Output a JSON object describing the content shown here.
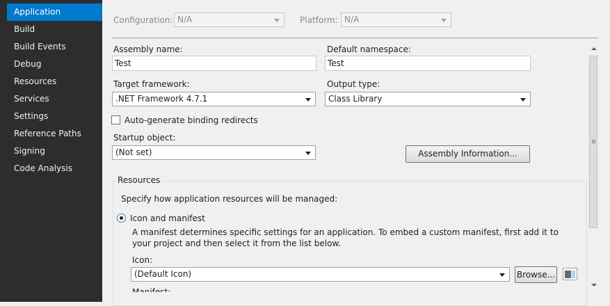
{
  "sidebar": {
    "items": [
      {
        "label": "Application"
      },
      {
        "label": "Build"
      },
      {
        "label": "Build Events"
      },
      {
        "label": "Debug"
      },
      {
        "label": "Resources"
      },
      {
        "label": "Services"
      },
      {
        "label": "Settings"
      },
      {
        "label": "Reference Paths"
      },
      {
        "label": "Signing"
      },
      {
        "label": "Code Analysis"
      }
    ],
    "active_index": 0
  },
  "header": {
    "configuration_label": "Configuration:",
    "configuration_value": "N/A",
    "platform_label": "Platform:",
    "platform_value": "N/A"
  },
  "form": {
    "assembly_name_label": "Assembly name:",
    "assembly_name_value": "Test",
    "default_namespace_label": "Default namespace:",
    "default_namespace_value": "Test",
    "target_framework_label": "Target framework:",
    "target_framework_value": ".NET Framework 4.7.1",
    "output_type_label": "Output type:",
    "output_type_value": "Class Library",
    "auto_binding_label": "Auto-generate binding redirects",
    "auto_binding_checked": false,
    "startup_object_label": "Startup object:",
    "startup_object_value": "(Not set)",
    "assembly_info_button": "Assembly Information..."
  },
  "resources": {
    "group_title": "Resources",
    "description": "Specify how application resources will be managed:",
    "icon_manifest_label": "Icon and manifest",
    "icon_manifest_selected": true,
    "manifest_desc_line1": "A manifest determines specific settings for an application. To embed a custom manifest, first add it to",
    "manifest_desc_line2": "your project and then select it from the list below.",
    "icon_label": "Icon:",
    "icon_value": "(Default Icon)",
    "browse_button": "Browse...",
    "manifest_label_partial": "Manifest:"
  },
  "colors": {
    "sidebar_bg": "#2d2d30",
    "accent": "#007acc",
    "panel_bg": "#f0f0f0"
  }
}
